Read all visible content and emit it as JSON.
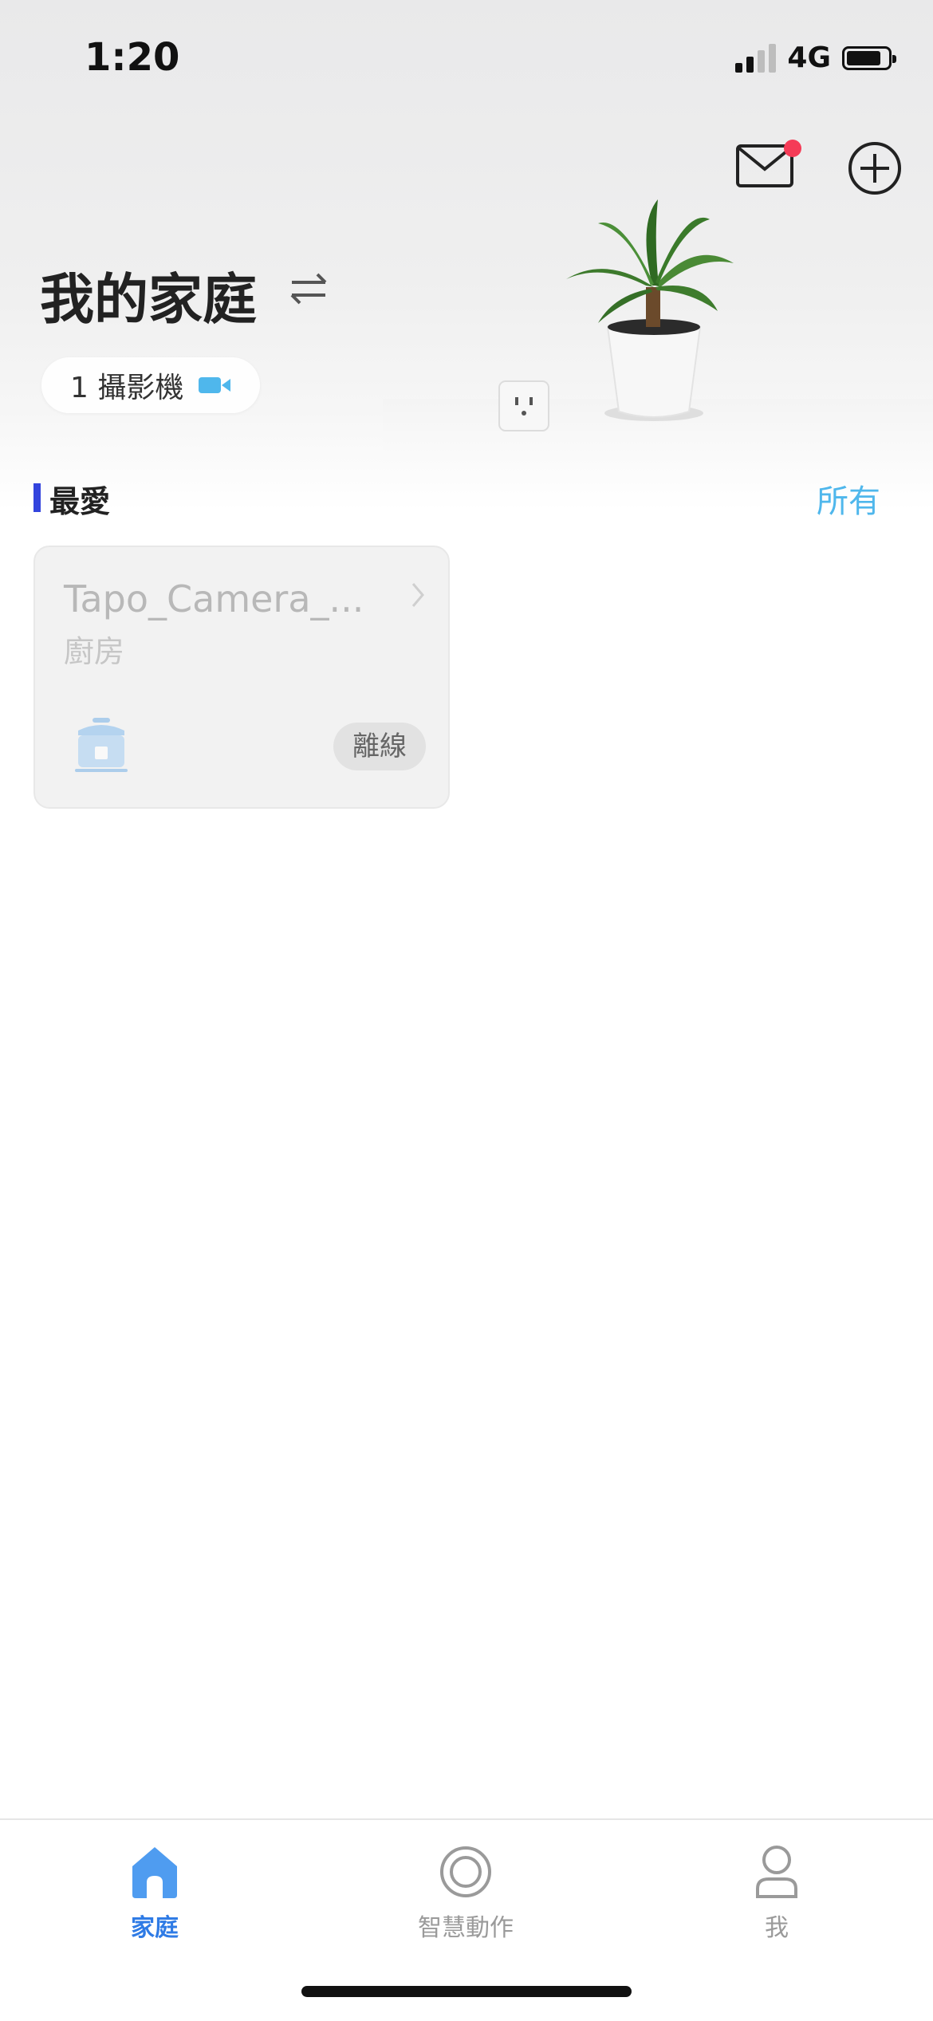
{
  "status_bar": {
    "time": "1:20",
    "network": "4G"
  },
  "header": {
    "home_name": "我的家庭",
    "camera_summary": "1 攝影機",
    "has_unread_message": true
  },
  "favorites": {
    "title": "最愛",
    "all_link": "所有",
    "devices": [
      {
        "name": "Tapo_Camera_...",
        "room": "廚房",
        "status": "離線",
        "icon": "rice-cooker-icon"
      }
    ]
  },
  "tabbar": {
    "tabs": [
      {
        "label": "家庭",
        "icon": "home-icon",
        "active": true
      },
      {
        "label": "智慧動作",
        "icon": "smart-action-icon",
        "active": false
      },
      {
        "label": "我",
        "icon": "person-icon",
        "active": false
      }
    ]
  },
  "colors": {
    "accent_blue": "#2f7be5",
    "link_blue": "#4fb7ec",
    "favorites_bar": "#3344dd",
    "notification_dot": "#f53b57"
  }
}
